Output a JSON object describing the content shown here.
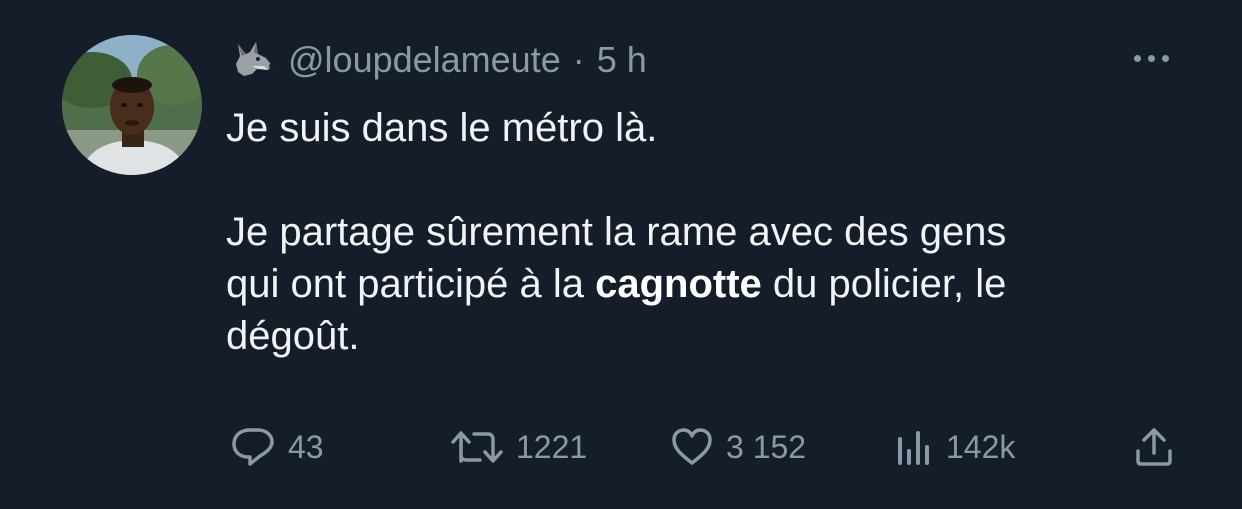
{
  "tweet": {
    "handle": "@loupdelameute",
    "separator": "·",
    "time": "5 h",
    "line1": "Je suis dans le métro là.",
    "line2_part1": "Je partage sûrement la rame avec des gens",
    "line2_part2a": "qui ont participé à la ",
    "line2_bold": "cagnotte",
    "line2_part2b": " du policier, le",
    "line2_part3": "dégoût."
  },
  "actions": {
    "replies": "43",
    "retweets": "1221",
    "likes": "3 152",
    "views": "142k"
  },
  "icons": {
    "author_emoji": "wolf-icon",
    "menu": "more-icon",
    "reply": "reply-icon",
    "retweet": "retweet-icon",
    "like": "heart-icon",
    "views": "analytics-icon",
    "share": "share-icon"
  },
  "colors": {
    "background": "#151d2b",
    "text": "#e7e9ea",
    "muted": "#8b98a5"
  }
}
